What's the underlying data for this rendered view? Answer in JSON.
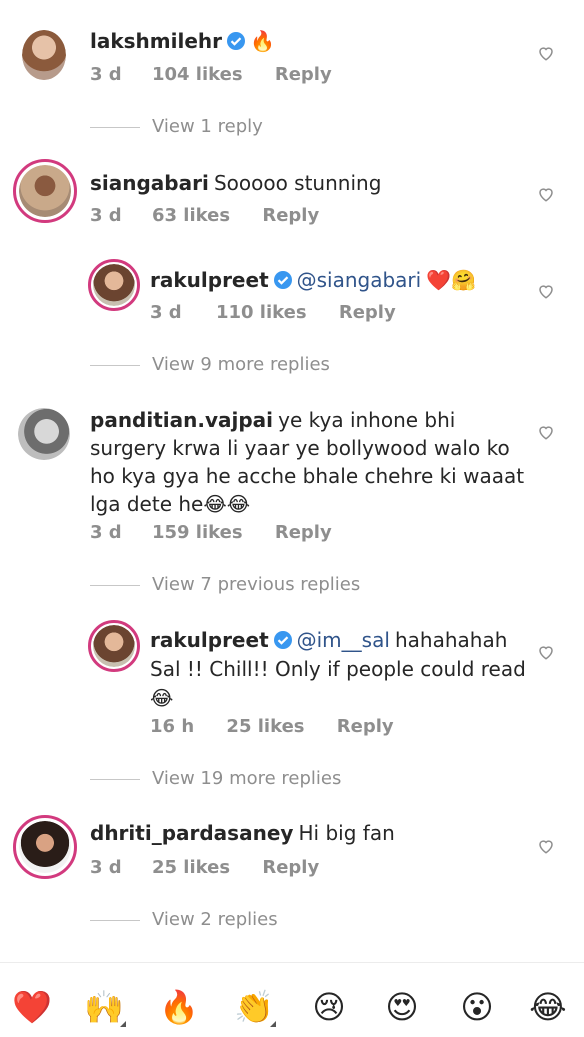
{
  "comments": [
    {
      "user": "lakshmilehr",
      "verified": true,
      "text": "🔥",
      "time": "3 d",
      "likes": "104 likes",
      "reply": "Reply",
      "view": "View 1 reply"
    },
    {
      "user": "siangabari",
      "verified": false,
      "text": "Sooooo stunning",
      "time": "3 d",
      "likes": "63 likes",
      "reply": "Reply"
    },
    {
      "user": "rakulpreet",
      "verified": true,
      "mention": "@siangabari",
      "text": "❤️🤗",
      "time": "3 d",
      "likes": "110 likes",
      "reply": "Reply",
      "view": "View 9 more replies"
    },
    {
      "user": "panditian.vajpai",
      "verified": false,
      "text": "ye kya inhone bhi surgery krwa li yaar ye bollywood walo ko ho kya gya he acche bhale chehre ki waaat lga dete he😂😂",
      "time": "3 d",
      "likes": "159 likes",
      "reply": "Reply",
      "view": "View 7 previous replies"
    },
    {
      "user": "rakulpreet",
      "verified": true,
      "mention": "@im__sal",
      "text": "hahahahah Sal !! Chill!! Only if people could read 😂",
      "time": "16 h",
      "likes": "25 likes",
      "reply": "Reply",
      "view": "View 19 more replies"
    },
    {
      "user": "dhriti_pardasaney",
      "verified": false,
      "text": "Hi big fan",
      "time": "3 d",
      "likes": "25 likes",
      "reply": "Reply",
      "view": "View 2 replies"
    }
  ],
  "emoji_bar": [
    "❤️",
    "🙌",
    "🔥",
    "👏",
    "😢",
    "😍",
    "😮",
    "😂"
  ],
  "colors": {
    "accent": "#3897f0",
    "mention": "#30548a",
    "muted": "#8e8e8e",
    "story_ring": "#d23a7e"
  }
}
